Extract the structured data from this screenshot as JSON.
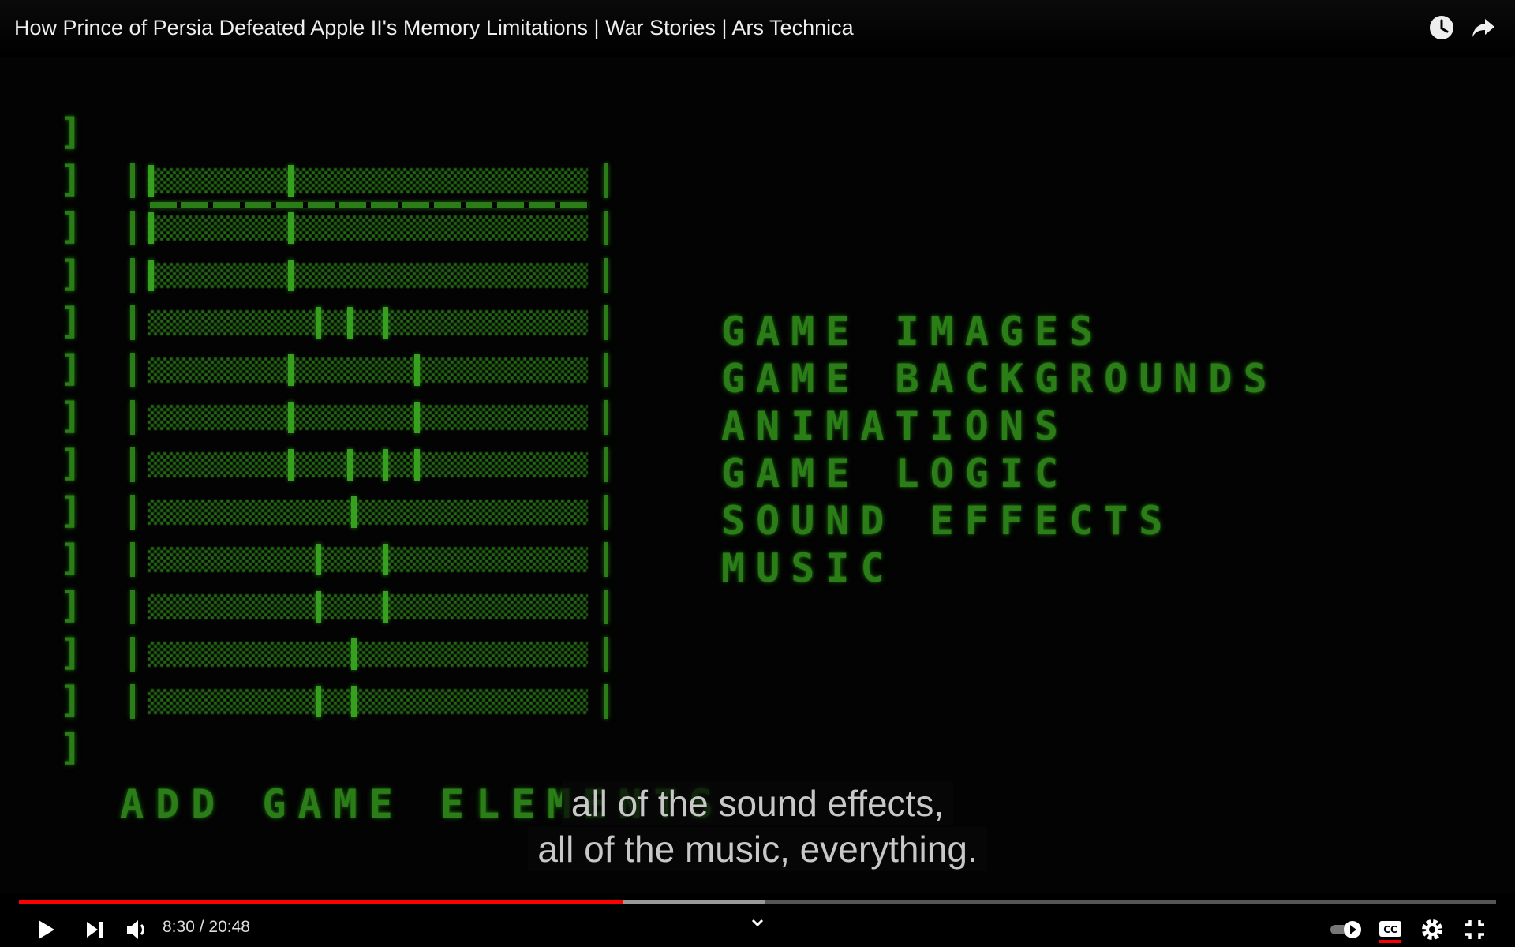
{
  "header": {
    "title": "How Prince of Persia Defeated Apple II's Memory Limitations | War Stories | Ars Technica"
  },
  "screen": {
    "menu_items": [
      "GAME IMAGES",
      "GAME BACKGROUNDS",
      "ANIMATIONS",
      "GAME LOGIC",
      "SOUND EFFECTS",
      "MUSIC"
    ],
    "footer_text": "ADD GAME ELEMENTS"
  },
  "captions": {
    "line1": "all of the sound effects,",
    "line2": "all of the music, everything."
  },
  "player": {
    "current_time": "8:30",
    "separator": " / ",
    "duration": "20:48",
    "played_fraction": 0.4093,
    "buffered_fraction": 0.5055
  },
  "icons": {
    "watch_later": "clock-icon",
    "share": "share-arrow-icon",
    "play": "play-icon",
    "next": "next-icon",
    "volume": "volume-icon",
    "expand": "chevron-down-icon",
    "autoplay": "autoplay-toggle-icon",
    "captions": "cc-icon",
    "settings": "gear-icon",
    "exit_fullscreen": "exit-fullscreen-icon"
  },
  "colors": {
    "accent": "#ff0000",
    "retro_green": "#2b7d18"
  }
}
